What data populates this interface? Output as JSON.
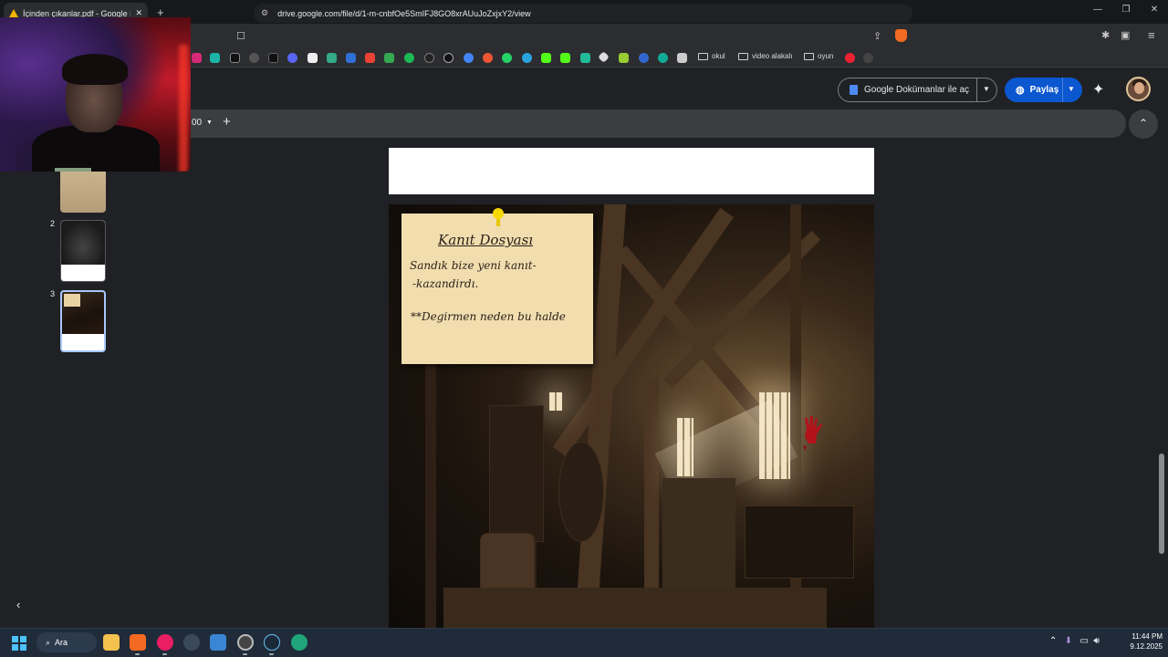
{
  "browser": {
    "tab_title": "İçinden çıkanlar.pdf - Google Dr",
    "tab_close": "✕",
    "new_tab": "+",
    "url": "drive.google.com/file/d/1-m-cnbfOe5SmIFJ8GO8xrAUuJoZxjxY2/view",
    "window_controls": [
      "—",
      "❐",
      "✕"
    ],
    "bookmark_folders": [
      "okul",
      "video alakalı",
      "oyun"
    ]
  },
  "drive": {
    "open_with_label": "Google Dokümanlar ile aç",
    "share_label": "Paylaş",
    "zoom_value": "00",
    "zoom_plus": "+"
  },
  "thumbnails": {
    "page2_number": "2",
    "page3_number": "3"
  },
  "document": {
    "note_title": "Kanıt Dosyası",
    "note_line1": "Sandık bize yeni kanıt-",
    "note_line2": "-kazandirdı.",
    "note_line3": "**Degirmen neden bu halde"
  },
  "taskbar": {
    "search_label": "Ara",
    "clock_time": "11:44 PM",
    "clock_date": "9.12.2025"
  },
  "colors": {
    "accent_blue": "#0b57d0",
    "note_paper": "#f2ddaf",
    "page_bg": "#202124"
  }
}
